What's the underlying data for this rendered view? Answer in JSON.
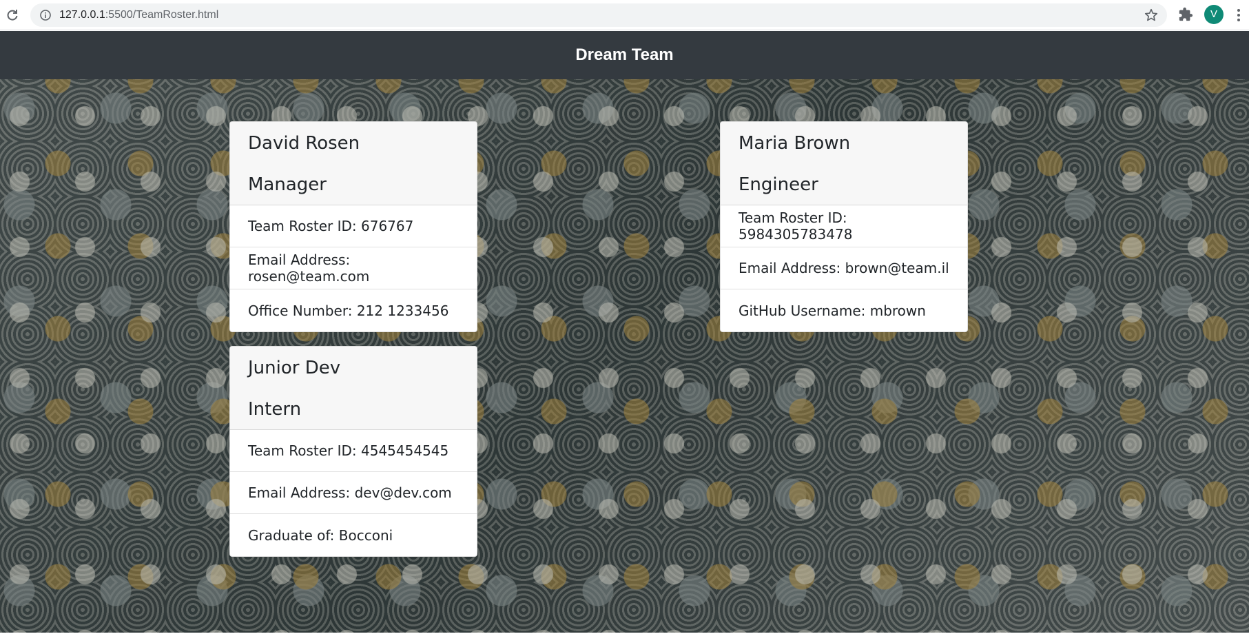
{
  "browser": {
    "url_host": "127.0.0.1",
    "url_path": ":5500/TeamRoster.html",
    "avatar_letter": "V",
    "avatar_color": "#0f8a76"
  },
  "header": {
    "title": "Dream Team",
    "background_color": "#343a40"
  },
  "cards": [
    {
      "name": "David Rosen",
      "role": "Manager",
      "id_line": "Team Roster ID: 676767",
      "email_line": "Email Address: rosen@team.com",
      "extra_line": "Office Number: 212 1233456"
    },
    {
      "name": "Maria Brown",
      "role": "Engineer",
      "id_line": "Team Roster ID: 5984305783478",
      "email_line": "Email Address: brown@team.il",
      "extra_line": "GitHub Username: mbrown"
    },
    {
      "name": "Junior Dev",
      "role": "Intern",
      "id_line": "Team Roster ID: 4545454545",
      "email_line": "Email Address: dev@dev.com",
      "extra_line": "Graduate of: Bocconi"
    }
  ],
  "icons": {
    "reload": "reload-icon",
    "info": "info-icon",
    "star": "star-icon",
    "extensions": "puzzle-icon",
    "menu": "kebab-menu-icon"
  }
}
